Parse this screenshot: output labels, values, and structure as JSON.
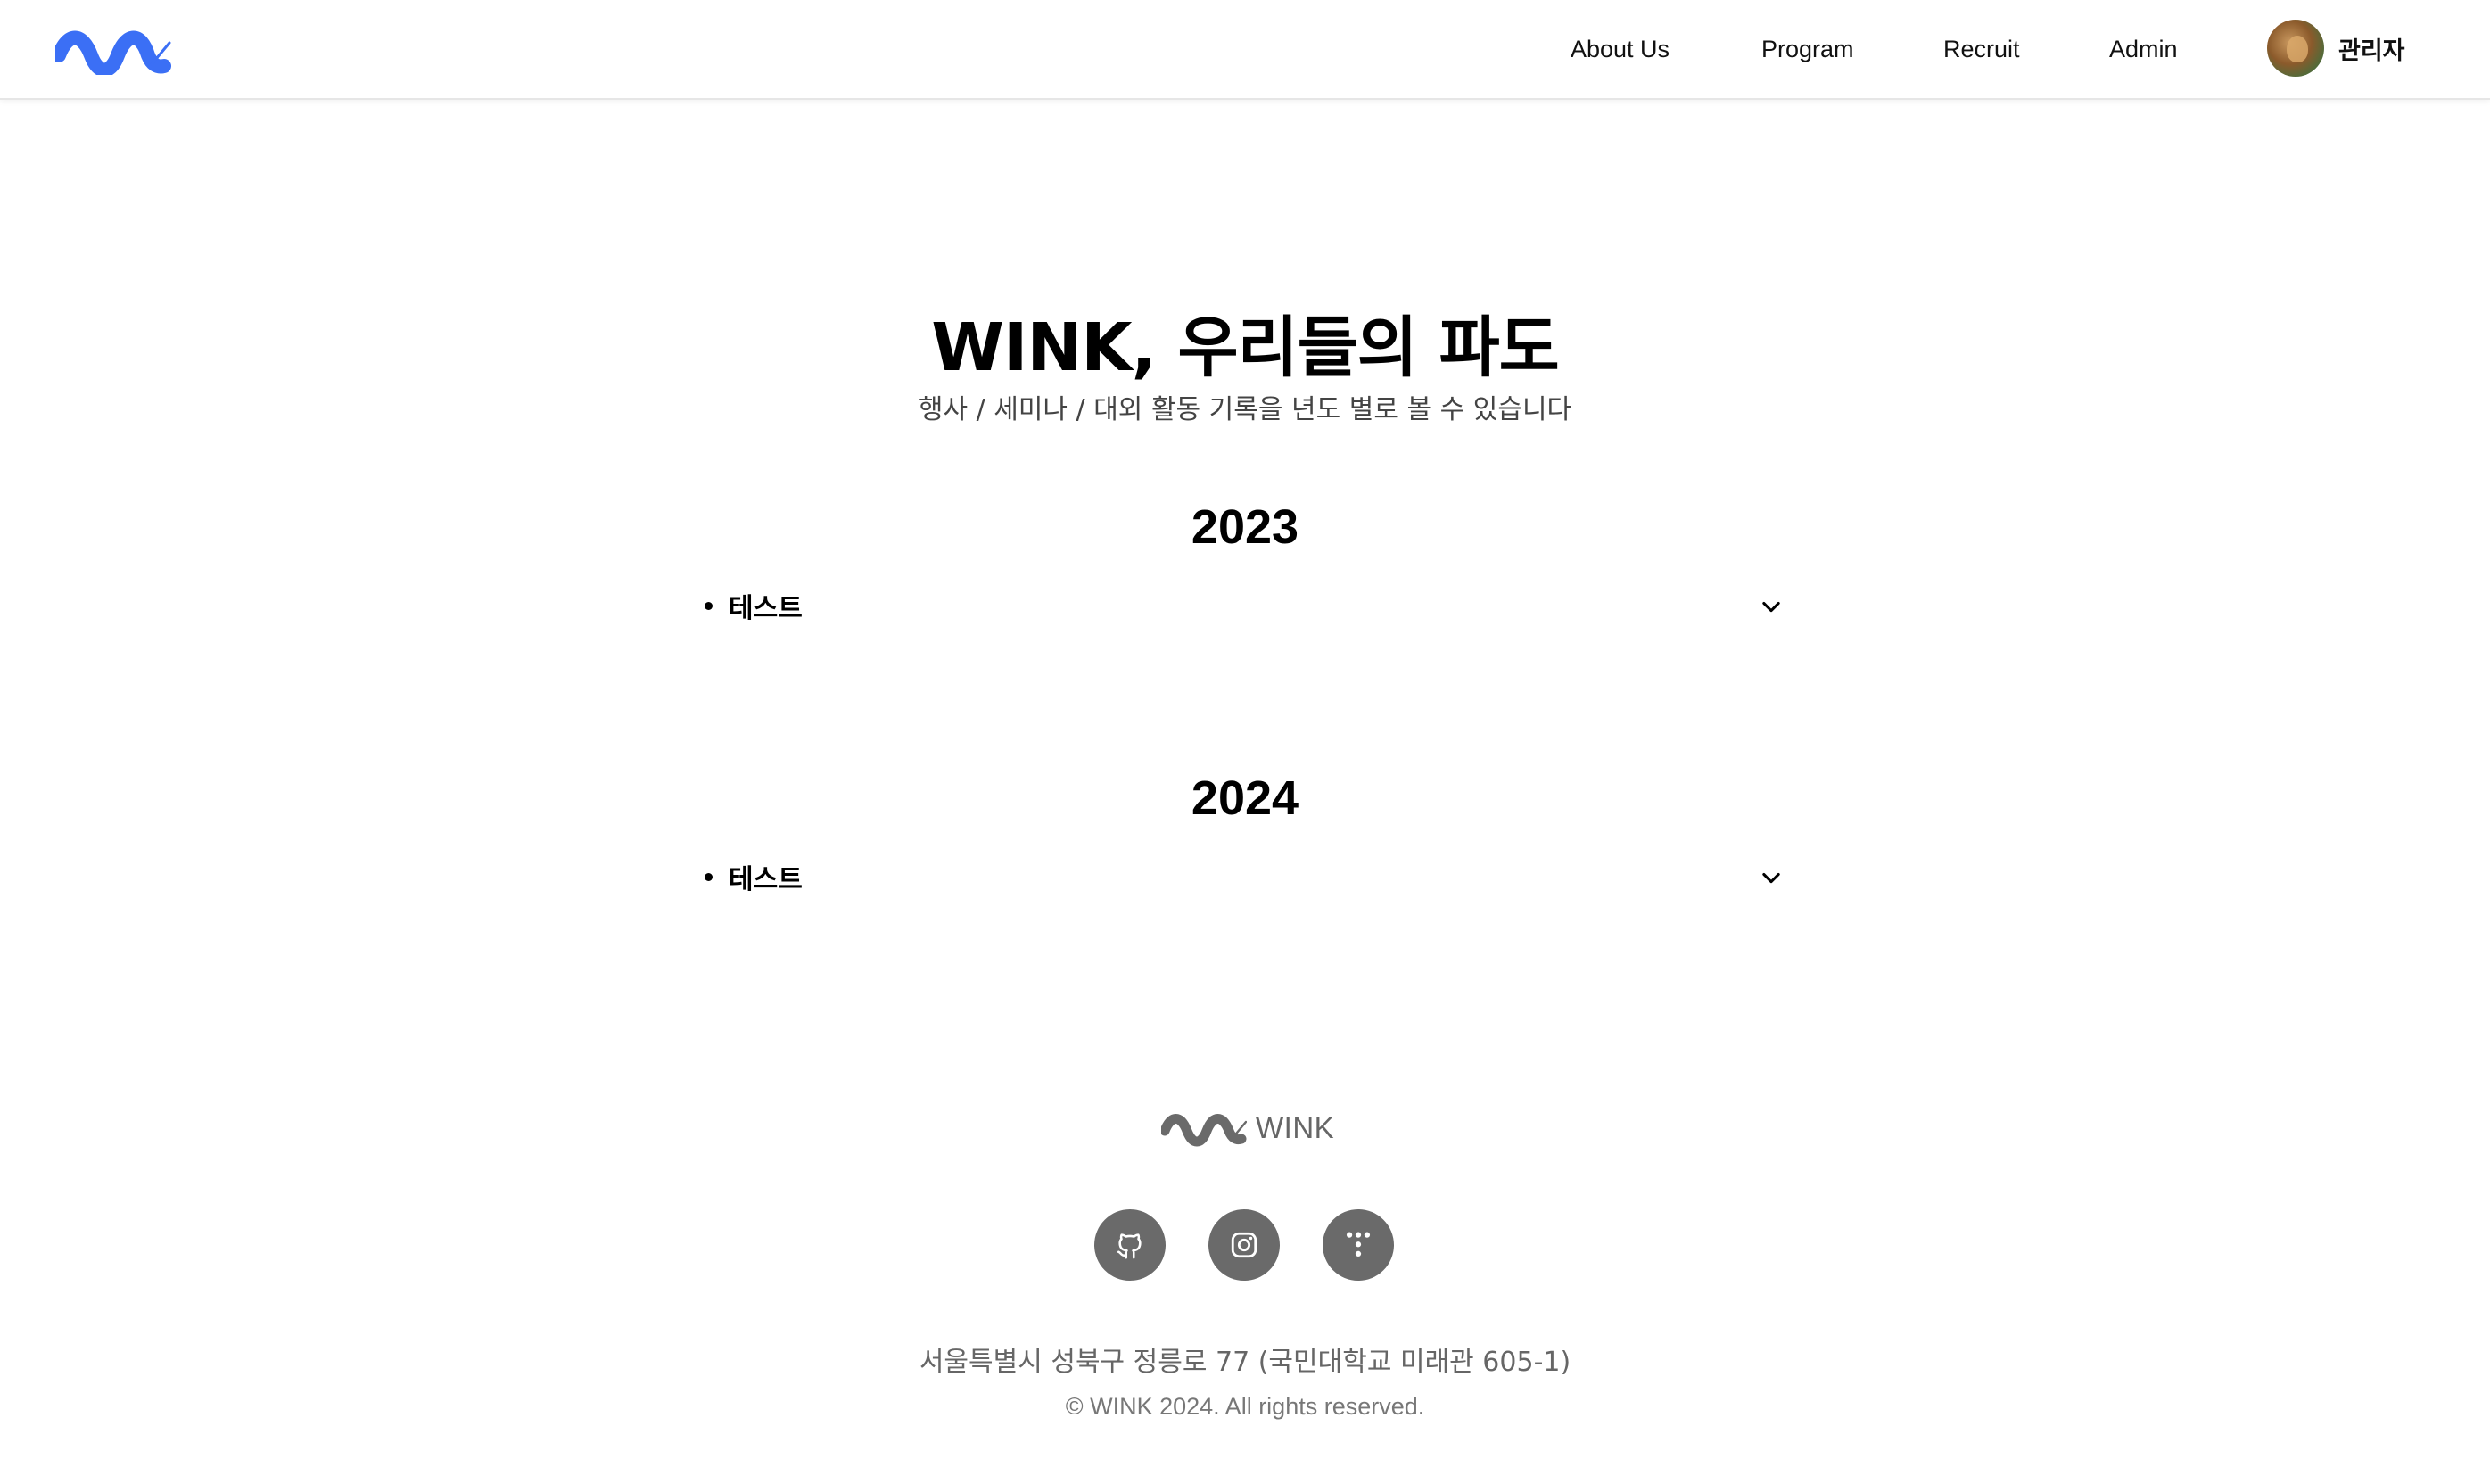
{
  "header": {
    "nav": [
      {
        "label": "About Us"
      },
      {
        "label": "Program"
      },
      {
        "label": "Recruit"
      },
      {
        "label": "Admin"
      }
    ],
    "user": {
      "name": "관리자"
    }
  },
  "hero": {
    "title": "WINK, 우리들의 파도",
    "subtitle": "행사 / 세미나 / 대외 활동 기록을 년도 별로 볼 수 있습니다"
  },
  "years": [
    {
      "year": "2023",
      "events": [
        {
          "label": "테스트"
        }
      ]
    },
    {
      "year": "2024",
      "events": [
        {
          "label": "테스트"
        }
      ]
    }
  ],
  "footer": {
    "brand": "WINK",
    "social": [
      {
        "icon": "github-icon"
      },
      {
        "icon": "instagram-icon"
      },
      {
        "icon": "tistory-icon"
      }
    ],
    "address": "서울특별시 성북구 정릉로 77 (국민대학교 미래관 605-1)",
    "copyright": "© WINK 2024. All rights reserved."
  },
  "colors": {
    "brand_blue": "#3b6ff5",
    "footer_gray": "#6a6a6a"
  }
}
